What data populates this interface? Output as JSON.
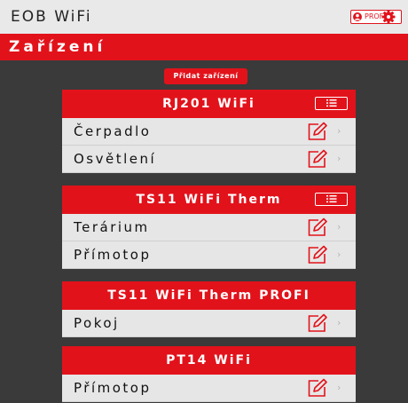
{
  "app": {
    "title": "EOB WiFi",
    "profile_label": "PROFIL"
  },
  "header": {
    "title": "Zařízení"
  },
  "actions": {
    "add_device_label": "Přidat zařízení"
  },
  "devices": [
    {
      "name": "RJ201 WiFi",
      "has_menu": true,
      "items": [
        {
          "label": "Čerpadlo"
        },
        {
          "label": "Osvětlení"
        }
      ]
    },
    {
      "name": "TS11 WiFi Therm",
      "has_menu": true,
      "items": [
        {
          "label": "Terárium"
        },
        {
          "label": "Přímotop"
        }
      ]
    },
    {
      "name": "TS11 WiFi Therm PROFI",
      "has_menu": false,
      "items": [
        {
          "label": "Pokoj"
        }
      ]
    },
    {
      "name": "PT14 WiFi",
      "has_menu": false,
      "items": [
        {
          "label": "Přímotop"
        }
      ]
    }
  ],
  "colors": {
    "accent": "#e2121b",
    "background": "#3a3a3a",
    "row": "#e6e6e6"
  },
  "icons": {
    "profile": "user-icon",
    "settings": "gear-icon",
    "menu": "list-icon",
    "edit": "pencil-edit-icon",
    "more": "chevron-right-icon"
  }
}
